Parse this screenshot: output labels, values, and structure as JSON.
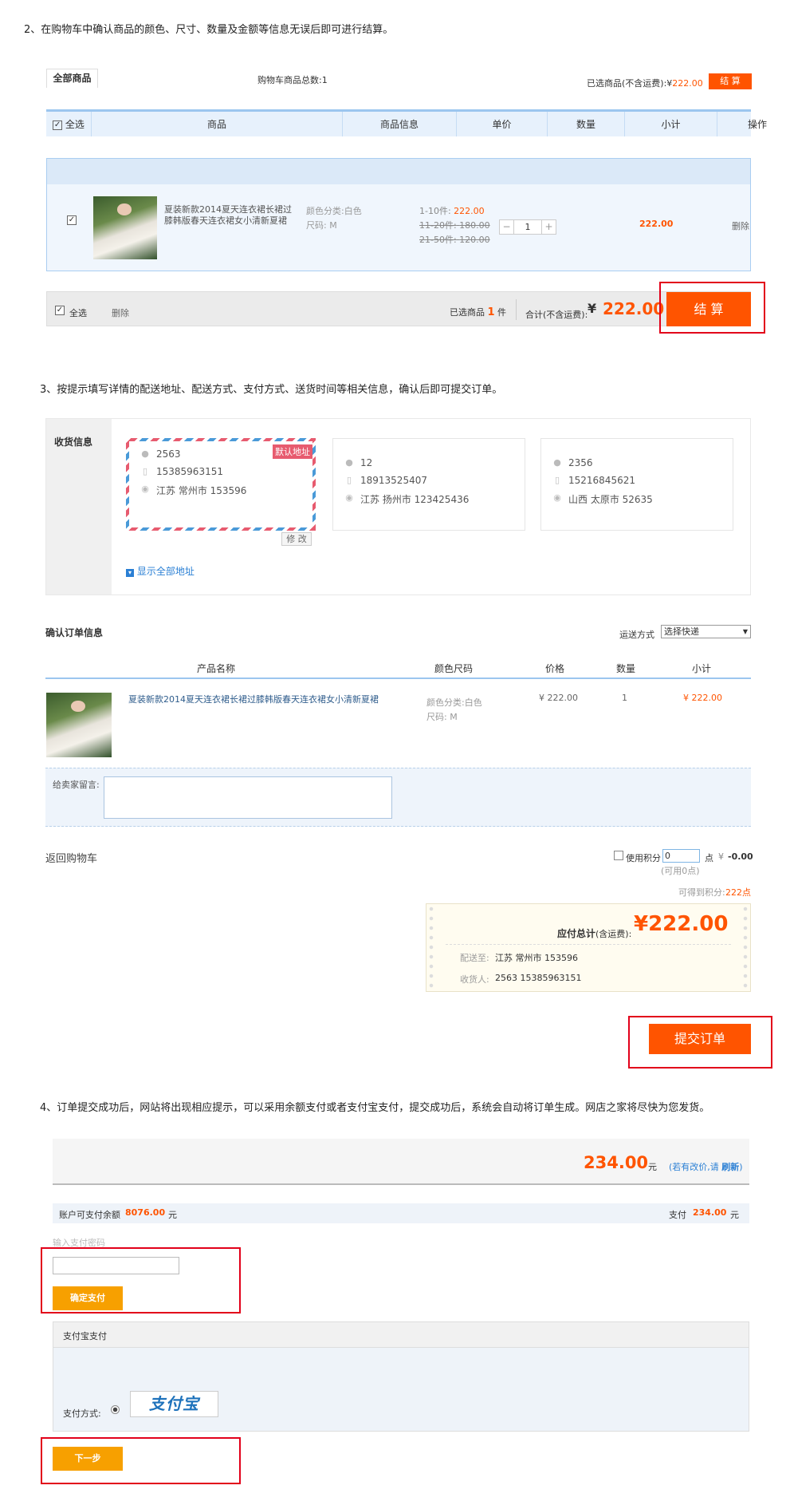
{
  "step2": {
    "title": "2、在购物车中确认商品的颜色、尺寸、数量及金额等信息无误后即可进行结算。",
    "tab_all": "全部商品",
    "cart_total": "购物车商品总数:1",
    "selected_prefix": "已选商品(不含运费):¥",
    "selected_amount": "222.00",
    "checkout_small": "结 算",
    "headers": [
      "全选",
      "商品",
      "商品信息",
      "单价",
      "数量",
      "小计",
      "操作"
    ],
    "item": {
      "name": "夏装新款2014夏天连衣裙长裙过膝韩版春天连衣裙女小清新夏裙",
      "color": "颜色分类:白色",
      "size": "尺码: M",
      "tiers": [
        {
          "range": "1-10件:",
          "price": "222.00"
        },
        {
          "range": "11-20件:",
          "price": "180.00"
        },
        {
          "range": "21-50件:",
          "price": "120.00"
        }
      ],
      "qty": "1",
      "minus": "−",
      "plus": "+",
      "subtotal": "222.00",
      "delete": "删除"
    },
    "footer": {
      "select_all": "全选",
      "delete": "删除",
      "selected_label": "已选商品",
      "selected_count": "1",
      "unit": "件",
      "total_label": "合计(不含运费):",
      "currency": "¥",
      "total_amount": "222.00",
      "checkout": "结 算"
    }
  },
  "step3": {
    "title": "3、按提示填写详情的配送地址、配送方式、支付方式、送货时间等相关信息，确认后即可提交订单。",
    "receiver_label": "收货信息",
    "default_badge": "默认地址",
    "edit": "修 改",
    "show_all": "显示全部地址",
    "addresses": [
      {
        "name": "2563",
        "phone": "15385963151",
        "addr": "江苏   常州市   153596"
      },
      {
        "name": "12",
        "phone": "18913525407",
        "addr": "江苏   扬州市   123425436"
      },
      {
        "name": "2356",
        "phone": "15216845621",
        "addr": "山西   太原市   52635"
      }
    ],
    "confirm_title": "确认订单信息",
    "shipping_label": "运送方式",
    "shipping_value": "选择快递",
    "headers": [
      "产品名称",
      "颜色尺码",
      "价格",
      "数量",
      "小计"
    ],
    "item": {
      "name": "夏装新款2014夏天连衣裙长裙过膝韩版春天连衣裙女小清新夏裙",
      "color": "颜色分类:白色",
      "size": "尺码: M",
      "price": "¥ 222.00",
      "qty": "1",
      "subtotal": "¥ 222.00"
    },
    "message_label": "给卖家留言:",
    "back_cart": "返回购物车",
    "use_points": "使用积分",
    "points_value": "0",
    "points_unit": "点",
    "points_discount_prefix": "¥",
    "points_discount": "-0.00",
    "available_points": "(可用0点)",
    "earn_label": "可得到积分:",
    "earn_value": "222点",
    "payable_label": "应付总计",
    "payable_note": "(含运费):",
    "payable_amount": "¥222.00",
    "ship_to_label": "配送至:",
    "ship_to_value": "江苏   常州市   153596",
    "receiver_label2": "收货人:",
    "receiver_value": "2563 15385963151",
    "submit": "提交订单"
  },
  "step4": {
    "title": "4、订单提交成功后，网站将出现相应提示，可以采用余额支付或者支付宝支付，提交成功后，系统会自动将订单生成。网店之家将尽快为您发货。",
    "amount": "234.00",
    "yuan": "元",
    "change_note": "(若有改价,请",
    "refresh": "刷新",
    "note_close": ")",
    "balance_label": "账户可支付余额",
    "balance_value": "8076.00",
    "pay_label": "支付",
    "pay_value": "234.00",
    "pwd_label": "输入支付密码",
    "confirm_pay": "确定支付",
    "alipay_title": "支付宝支付",
    "pay_method_label": "支付方式:",
    "alipay_logo": "支付宝",
    "next": "下一步"
  },
  "colors": {
    "accent_orange": "#ff5400",
    "header_blue": "#e7f1fc",
    "frame_red": "#e2001a",
    "button_amber": "#f7a000"
  }
}
